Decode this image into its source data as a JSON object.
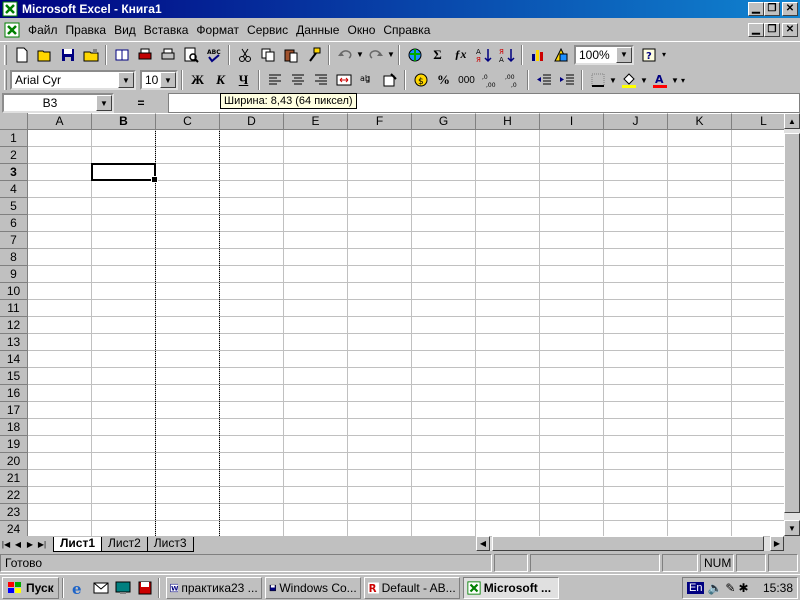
{
  "window": {
    "title": "Microsoft Excel - Книга1"
  },
  "menu": {
    "items": [
      "Файл",
      "Правка",
      "Вид",
      "Вставка",
      "Формат",
      "Сервис",
      "Данные",
      "Окно",
      "Справка"
    ]
  },
  "toolbar_std": {
    "zoom": "100%"
  },
  "toolbar_fmt": {
    "font": "Arial Cyr",
    "size": "10",
    "bold": "Ж",
    "italic": "К",
    "underline": "Ч",
    "percent": "%",
    "thousands": "000"
  },
  "formula_bar": {
    "name_box": "B3",
    "eq": "=",
    "value": ""
  },
  "tooltip": "Ширина: 8,43 (64 пиксел)",
  "grid": {
    "columns": [
      "A",
      "B",
      "C",
      "D",
      "E",
      "F",
      "G",
      "H",
      "I",
      "J",
      "K",
      "L"
    ],
    "rows": [
      "1",
      "2",
      "3",
      "4",
      "5",
      "6",
      "7",
      "8",
      "9",
      "10",
      "11",
      "12",
      "13",
      "14",
      "15",
      "16",
      "17",
      "18",
      "19",
      "20",
      "21",
      "22",
      "23",
      "24"
    ],
    "selected_column": "B",
    "selected_row": "3"
  },
  "sheets": {
    "tabs": [
      "Лист1",
      "Лист2",
      "Лист3"
    ],
    "active": "Лист1"
  },
  "status": {
    "text": "Готово",
    "num": "NUM"
  },
  "taskbar": {
    "start": "Пуск",
    "tasks": [
      {
        "label": "практика23 ...",
        "active": false
      },
      {
        "label": "Windows Co...",
        "active": false
      },
      {
        "label": "Default - AB...",
        "active": false
      },
      {
        "label": "Microsoft ...",
        "active": true
      }
    ],
    "lang": "En",
    "clock": "15:38"
  },
  "colors": {
    "title_start": "#000080",
    "title_end": "#1084d0",
    "face": "#c0c0c0",
    "excel_green": "#008000"
  }
}
